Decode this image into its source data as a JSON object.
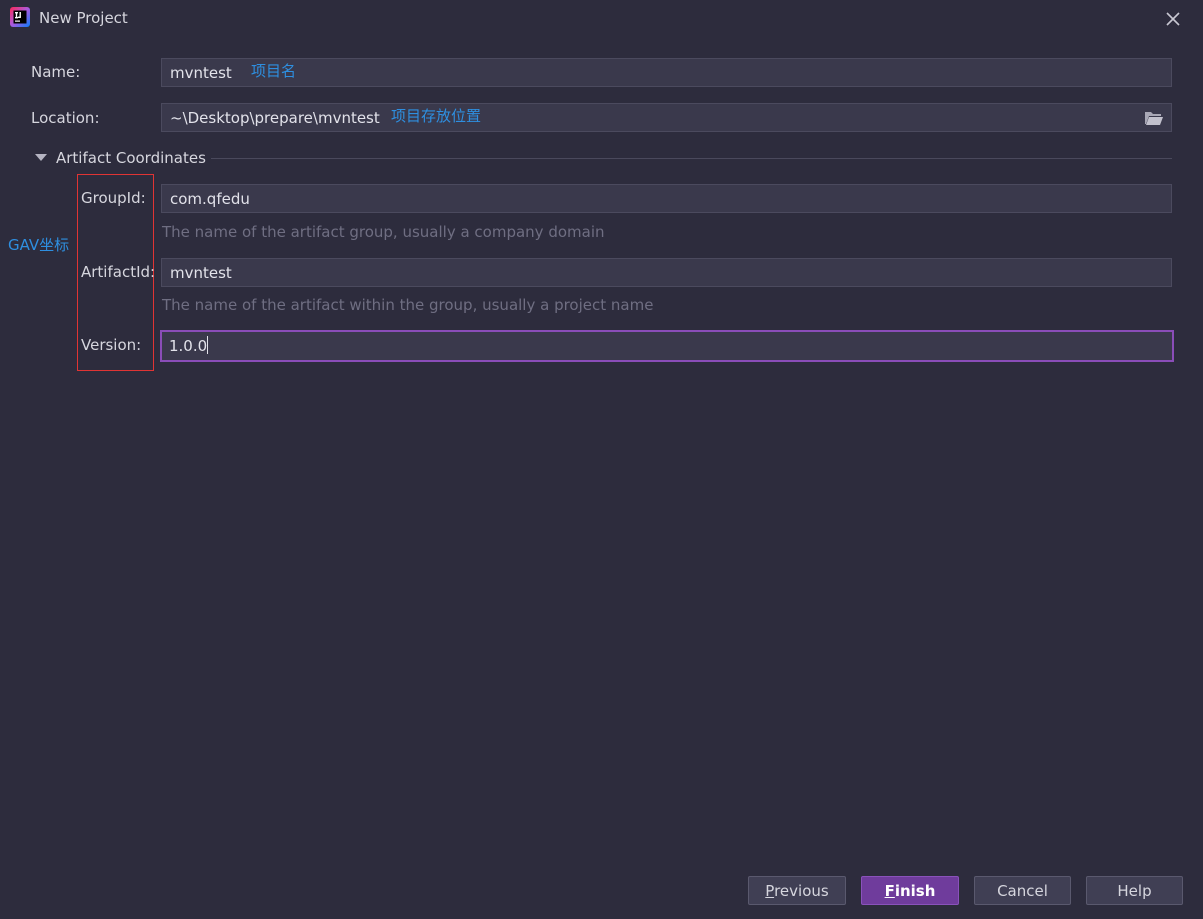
{
  "window": {
    "title": "New Project",
    "icon": "intellij-idea-icon",
    "close_icon": "close-icon"
  },
  "form": {
    "name": {
      "label": "Name:",
      "value": "mvntest",
      "annotation": "项目名"
    },
    "location": {
      "label": "Location:",
      "value": "~\\Desktop\\prepare\\mvntest",
      "annotation": "项目存放位置",
      "browse_icon": "folder-open-icon"
    },
    "artifact_section": {
      "title": "Artifact Coordinates",
      "expanded": true
    },
    "gav_annotation": "GAV坐标",
    "group_id": {
      "label": "GroupId:",
      "value": "com.qfedu",
      "hint": "The name of the artifact group, usually a company domain"
    },
    "artifact_id": {
      "label": "ArtifactId:",
      "value": "mvntest",
      "hint": "The name of the artifact within the group, usually a project name"
    },
    "version": {
      "label": "Version:",
      "value": "1.0.0"
    }
  },
  "buttons": {
    "previous": {
      "mnemonic": "P",
      "rest": "revious"
    },
    "finish": {
      "mnemonic": "F",
      "rest": "inish"
    },
    "cancel": "Cancel",
    "help": "Help"
  },
  "colors": {
    "background": "#2d2c3d",
    "field": "#3a394c",
    "focus_border": "#8a4db8",
    "primary_button": "#6f3c9c",
    "annotation": "#2e8fe0",
    "annotation_box": "#e03434"
  }
}
